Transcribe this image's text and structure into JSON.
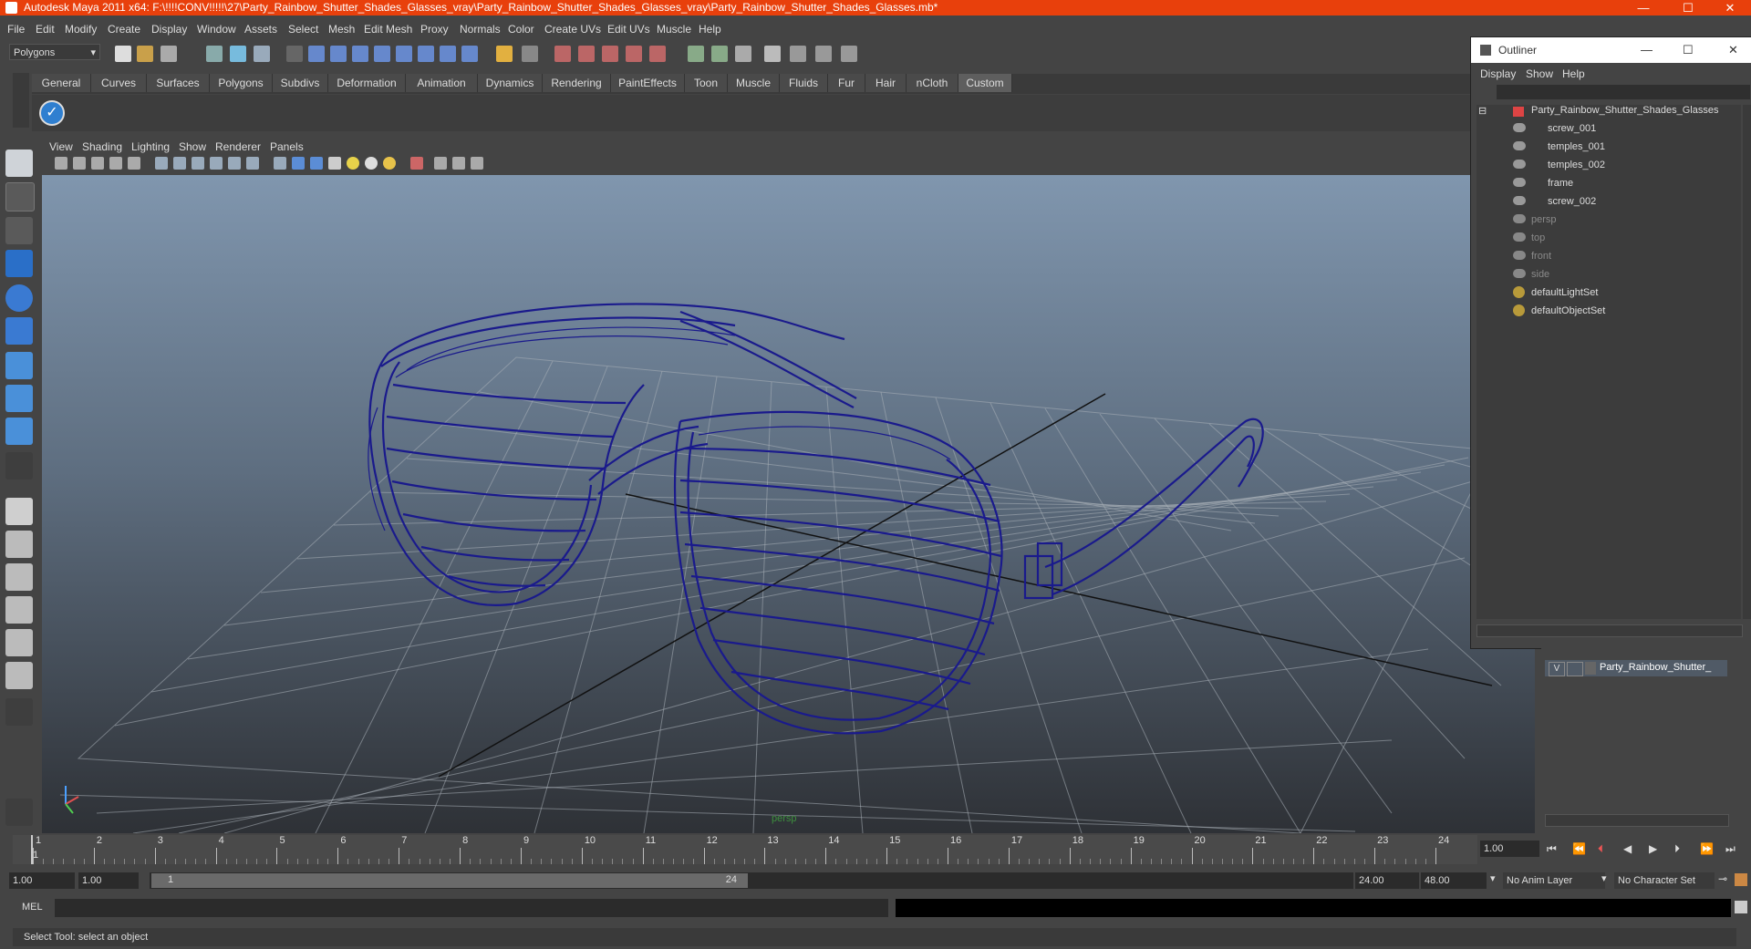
{
  "window": {
    "title": "Autodesk Maya 2011 x64: F:\\!!!!CONV!!!!!\\27\\Party_Rainbow_Shutter_Shades_Glasses_vray\\Party_Rainbow_Shutter_Shades_Glasses_vray\\Party_Rainbow_Shutter_Shades_Glasses.mb*",
    "minimize": "—",
    "maximize": "☐",
    "close": "✕"
  },
  "menubar": [
    "File",
    "Edit",
    "Modify",
    "Create",
    "Display",
    "Window",
    "Assets",
    "Select",
    "Mesh",
    "Edit Mesh",
    "Proxy",
    "Normals",
    "Color",
    "Create UVs",
    "Edit UVs",
    "Muscle",
    "Help"
  ],
  "mode_selector": "Polygons",
  "shelf_tabs": [
    "General",
    "Curves",
    "Surfaces",
    "Polygons",
    "Subdivs",
    "Deformation",
    "Animation",
    "Dynamics",
    "Rendering",
    "PaintEffects",
    "Toon",
    "Muscle",
    "Fluids",
    "Fur",
    "Hair",
    "nCloth",
    "Custom"
  ],
  "shelf_active": "Custom",
  "viewport_menu": [
    "View",
    "Shading",
    "Lighting",
    "Show",
    "Renderer",
    "Panels"
  ],
  "viewport_camera_label": "persp",
  "outliner": {
    "title": "Outliner",
    "menu": [
      "Display",
      "Show",
      "Help"
    ],
    "items": [
      {
        "label": "Party_Rainbow_Shutter_Shades_Glasses",
        "level": 0,
        "dim": false
      },
      {
        "label": "screw_001",
        "level": 1,
        "dim": false
      },
      {
        "label": "temples_001",
        "level": 1,
        "dim": false
      },
      {
        "label": "temples_002",
        "level": 1,
        "dim": false
      },
      {
        "label": "frame",
        "level": 1,
        "dim": false
      },
      {
        "label": "screw_002",
        "level": 1,
        "dim": false
      },
      {
        "label": "persp",
        "level": 0,
        "dim": true
      },
      {
        "label": "top",
        "level": 0,
        "dim": true
      },
      {
        "label": "front",
        "level": 0,
        "dim": true
      },
      {
        "label": "side",
        "level": 0,
        "dim": true
      },
      {
        "label": "defaultLightSet",
        "level": 0,
        "dim": false
      },
      {
        "label": "defaultObjectSet",
        "level": 0,
        "dim": false
      }
    ]
  },
  "layer": {
    "visible": "V",
    "name": "Party_Rainbow_Shutter_"
  },
  "timeline": {
    "ticks": [
      "1",
      "2",
      "3",
      "4",
      "5",
      "6",
      "7",
      "8",
      "9",
      "10",
      "11",
      "12",
      "13",
      "14",
      "15",
      "16",
      "17",
      "18",
      "19",
      "20",
      "21",
      "22",
      "23",
      "24"
    ],
    "current_frame_marker": "1",
    "current_time": "1.00"
  },
  "range": {
    "start": "1.00",
    "playback_start": "1.00",
    "slider_start": "1",
    "slider_end": "24",
    "playback_end": "24.00",
    "end": "48.00",
    "anim_layer": "No Anim Layer",
    "character_set": "No Character Set"
  },
  "command": {
    "lang": "MEL"
  },
  "help_line": "Select Tool: select an object",
  "colors": {
    "titlebar": "#e8400c",
    "wireframe": "#1a1a8c",
    "ui_bg": "#444444"
  }
}
